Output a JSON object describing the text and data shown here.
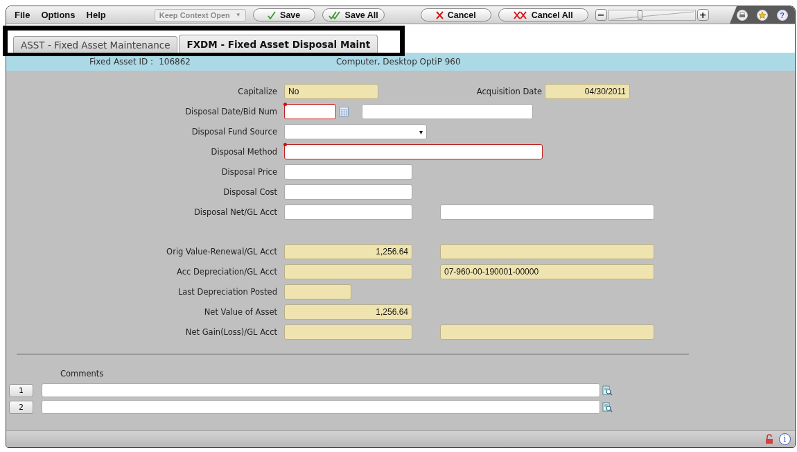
{
  "menu": [
    "File",
    "Options",
    "Help"
  ],
  "toolbar": {
    "context": {
      "label": "Keep Context Open",
      "caret": "▼",
      "disabled": true
    },
    "buttons": [
      {
        "label": "Save",
        "kind": "check"
      },
      {
        "label": "Save All",
        "kind": "double-check"
      },
      {
        "label": "Cancel",
        "kind": "cross"
      },
      {
        "label": "Cancel All",
        "kind": "double-cross"
      }
    ],
    "zoom": {
      "minus": "−",
      "plus": "+",
      "level": 0.36
    },
    "help": "?"
  },
  "tabs": [
    {
      "label": "ASST - Fixed Asset Maintenance",
      "selected": false
    },
    {
      "label": "FXDM - Fixed Asset Disposal Maint",
      "selected": true
    }
  ],
  "header": {
    "id_label": "Fixed Asset ID :",
    "id_value": "106862",
    "description": "Computer, Desktop OptiP 960"
  },
  "form": {
    "rows": [
      {
        "label": "Capitalize",
        "fields": [
          {
            "kind": "display",
            "value": "No",
            "required": false
          }
        ],
        "extra": {
          "label": "Acquisition Date",
          "field": {
            "kind": "amount",
            "value": "04/30/2011",
            "required": false
          }
        }
      },
      {
        "label": "Disposal Date/Bid Num",
        "fields": [
          {
            "kind": "date",
            "required": true
          },
          {
            "kind": "input",
            "required": false
          }
        ]
      },
      {
        "label": "Disposal Fund Source",
        "fields": [
          {
            "kind": "select",
            "caret": "▾",
            "required": false
          }
        ]
      },
      {
        "label": "Disposal Method",
        "fields": [
          {
            "kind": "input",
            "required": true
          }
        ]
      },
      {
        "label": "Disposal Price",
        "fields": [
          {
            "kind": "input",
            "required": false
          }
        ]
      },
      {
        "label": "Disposal Cost",
        "fields": [
          {
            "kind": "input",
            "required": false
          }
        ]
      },
      {
        "label": "Disposal Net/GL Acct",
        "fields": [
          {
            "kind": "input",
            "required": false
          },
          {
            "kind": "input",
            "required": false
          }
        ]
      },
      {
        "label": "Orig Value-Renewal/GL Acct",
        "fields": [
          {
            "kind": "amount",
            "value": "1,256.64",
            "required": false
          },
          {
            "kind": "display",
            "required": false
          }
        ]
      },
      {
        "label": "Acc Depreciation/GL Acct",
        "fields": [
          {
            "kind": "amount",
            "required": false
          },
          {
            "kind": "display",
            "value": "07-960-00-190001-00000",
            "required": false
          }
        ]
      },
      {
        "label": "Last Depreciation Posted",
        "fields": [
          {
            "kind": "display",
            "required": false
          }
        ]
      },
      {
        "label": "Net Value of Asset",
        "fields": [
          {
            "kind": "amount",
            "value": "1,256.64",
            "required": false
          }
        ]
      },
      {
        "label": "Net Gain(Loss)/GL Acct",
        "fields": [
          {
            "kind": "amount",
            "required": false
          },
          {
            "kind": "display",
            "required": false
          }
        ]
      }
    ]
  },
  "comments": {
    "label": "Comments",
    "rows": [
      {
        "number": "1"
      },
      {
        "number": "2"
      }
    ]
  },
  "status_bar": {
    "info": "i"
  }
}
